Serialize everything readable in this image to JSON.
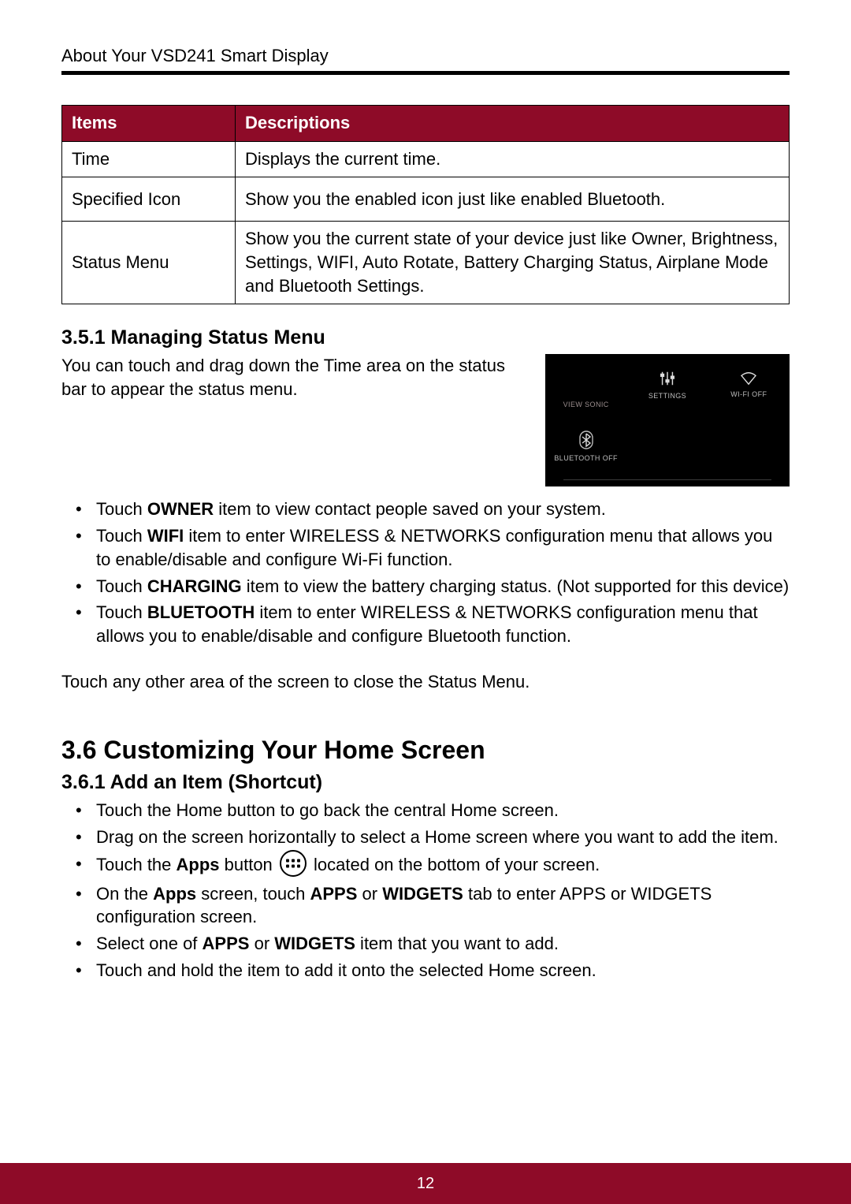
{
  "header": {
    "running_title": "About Your VSD241 Smart Display"
  },
  "table": {
    "head": {
      "items": "Items",
      "desc": "Descriptions"
    },
    "rows": [
      {
        "item": "Time",
        "desc": "Displays the current time."
      },
      {
        "item": "Specified Icon",
        "desc": "Show you the enabled icon just like enabled Bluetooth."
      },
      {
        "item": "Status Menu",
        "desc": "Show you the current state of your device just like Owner, Brightness, Settings, WIFI, Auto Rotate, Battery Charging Status, Airplane Mode and Bluetooth Settings."
      }
    ]
  },
  "s351": {
    "title": "3.5.1  Managing Status Menu",
    "lead": "You can touch and drag down the Time area on the status bar to appear the status menu.",
    "panel": {
      "owner": "VIEW SONIC",
      "settings": "SETTINGS",
      "wifi": "WI-FI OFF",
      "bluetooth": "BLUETOOTH OFF"
    },
    "bullets": [
      {
        "pre": "Touch ",
        "bold": "OWNER",
        "post": " item to view contact people saved on your system."
      },
      {
        "pre": "Touch ",
        "bold": "WIFI",
        "post": " item to enter WIRELESS & NETWORKS configuration menu that allows you to enable/disable and configure Wi-Fi function."
      },
      {
        "pre": "Touch ",
        "bold": "CHARGING",
        "post": " item to view the battery charging status. (Not supported for this device)"
      },
      {
        "pre": "Touch ",
        "bold": "BLUETOOTH",
        "post": " item to enter WIRELESS & NETWORKS configuration menu that allows you to enable/disable and configure Bluetooth function."
      }
    ],
    "closing": "Touch any other area of the screen to close the Status Menu."
  },
  "s36": {
    "title": "3.6  Customizing Your Home Screen",
    "s361_title": "3.6.1  Add an Item (Shortcut)",
    "bullets_a": [
      "Touch the Home button to go back the central Home screen.",
      "Drag on the screen horizontally to select a Home screen where you want to add the item."
    ],
    "apps_line": {
      "pre": "Touch the ",
      "bold": "Apps",
      "mid": " button ",
      "post": " located on the bottom of your screen."
    },
    "bullets_b": {
      "line1": {
        "pre": "On the ",
        "b1": "Apps",
        "mid1": " screen, touch ",
        "b2": "APPS",
        "mid2": " or ",
        "b3": "WIDGETS",
        "post": " tab to enter APPS or WIDGETS configuration screen."
      },
      "line2": {
        "pre": "Select one of ",
        "b1": "APPS",
        "mid": " or ",
        "b2": "WIDGETS",
        "post": " item that you want to add."
      },
      "line3": "Touch and hold the item to add it onto the selected Home screen."
    }
  },
  "footer": {
    "page_number": "12"
  }
}
